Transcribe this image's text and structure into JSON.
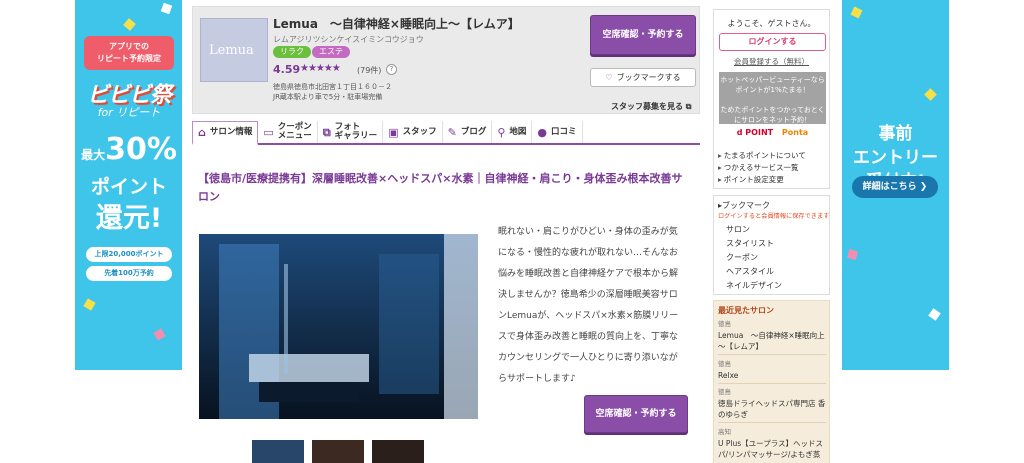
{
  "left_banner": {
    "header": "アプリでの\nリピート予約限定",
    "festival": "ビビビ祭",
    "for_repeat": "for リピート",
    "max_prefix": "最大",
    "percent": "30%",
    "point": "ポイント",
    "kangen": "還元!",
    "pill_1": "上限20,000ポイント",
    "pill_2": "先着100万予約",
    "colors": {
      "background": "#3fc4ea",
      "accent": "#f05d6a"
    }
  },
  "right_banner": {
    "title_line1": "事前",
    "title_line2": "エントリー",
    "title_line3": "受付中!",
    "details_button": "詳細はこちら ❯"
  },
  "salon": {
    "logo_text": "Lemua",
    "name": "Lemua　～自律神経×睡眠向上～【レムア】",
    "kana": "レムアジリツシンケイスイミンコウジョウ",
    "tags": [
      "リラク",
      "エステ"
    ],
    "rating": "4.59",
    "stars_value": 4.59,
    "review_count": "(79件)",
    "help_icon": "?",
    "address_line1": "徳島県徳島市北田宮１丁目１６０－２",
    "address_line2": "JR蔵本駅より車で5分・駐車場完備",
    "reserve_label": "空席確認・予約する",
    "bookmark_label": "ブックマークする",
    "staff_link": "スタッフ募集を見る"
  },
  "tabs": [
    {
      "icon": "home-icon",
      "label": "サロン情報"
    },
    {
      "icon": "coupon-icon",
      "label": "クーポン\nメニュー"
    },
    {
      "icon": "photo-icon",
      "label": "フォト\nギャラリー"
    },
    {
      "icon": "staff-icon",
      "label": "スタッフ"
    },
    {
      "icon": "blog-icon",
      "label": "ブログ"
    },
    {
      "icon": "map-pin-icon",
      "label": "地図"
    },
    {
      "icon": "comment-icon",
      "label": "口コミ"
    }
  ],
  "headline": "【徳島市/医療提携有】深層睡眠改善×ヘッドスパ×水素｜自律神経・肩こり・身体歪み根本改善サロン",
  "description": "眠れない・肩こりがひどい・身体の歪みが気になる・慢性的な疲れが取れない…そんなお悩みを睡眠改善と自律神経ケアで根本から解決しませんか？徳島希少の深層睡眠美容サロンLemuaが、ヘッドスパ×水素×筋膜リリースで身体歪み改善と睡眠の質向上を、丁寧なカウンセリングで一人ひとりに寄り添いながらサポートします♪",
  "sidebar": {
    "greeting": "ようこそ、ゲストさん。",
    "login_button": "ログインする",
    "register_link": "会員登録する（無料）",
    "point_info": "ホットペッパービューティーなら\nポイントが1%たまる！\n\nためたポイントをつかっておとく\nにサロンをネット予約！",
    "dpoint": "d POINT",
    "ponta": "Ponta",
    "links": [
      "たまるポイントについて",
      "つかえるサービス一覧",
      "ポイント設定変更"
    ],
    "bookmark_title": "ブックマーク",
    "bookmark_note": "ログインすると会員情報に保存できます",
    "bookmark_items": [
      "サロン",
      "スタイリスト",
      "クーポン",
      "ヘアスタイル",
      "ネイルデザイン"
    ],
    "recent_title": "最近見たサロン",
    "recent": [
      {
        "area": "徳島",
        "name": "Lemua　～自律神経×睡眠向上～【レムア】"
      },
      {
        "area": "徳島",
        "name": "Relxe"
      },
      {
        "area": "徳島",
        "name": "徳島ドライヘッドスパ専門店 香のゆらぎ"
      },
      {
        "area": "高知",
        "name": "U Plus【ユープラス】ヘッドスパ/リンパマッサージ/よもぎ蒸"
      }
    ]
  },
  "colors": {
    "brand_purple": "#8a4ea8",
    "link_pink": "#d33c6a",
    "notice_orange": "#e04d2a"
  }
}
